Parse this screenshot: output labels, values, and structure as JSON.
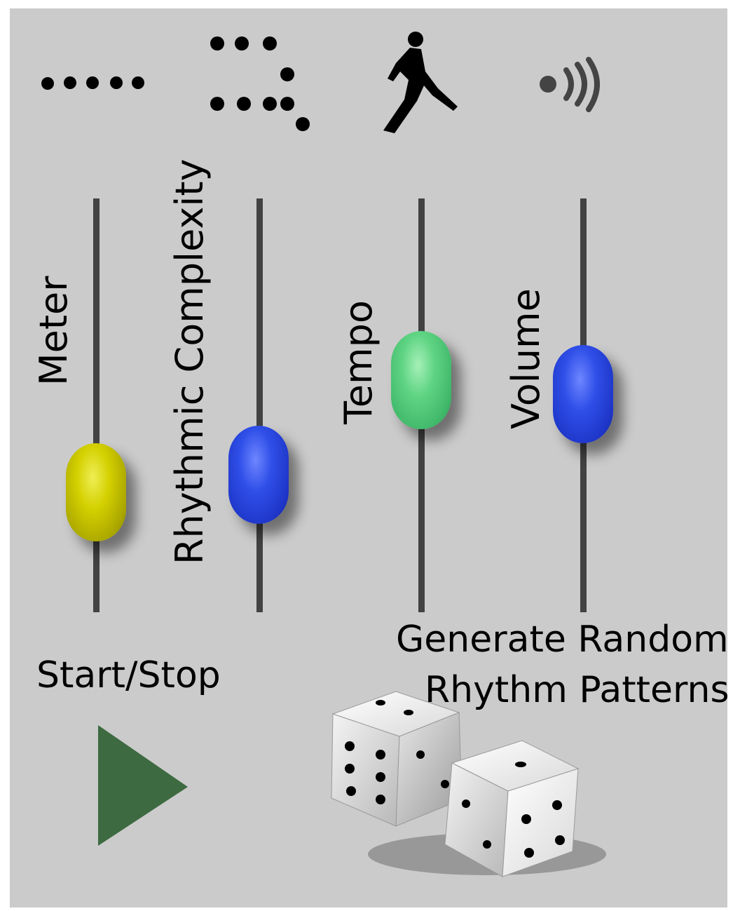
{
  "icons": {
    "meter": "four-dots-icon",
    "complexity": "dot-pattern-icon",
    "tempo": "runner-icon",
    "volume": "speaker-waves-icon",
    "play": "play-triangle-icon",
    "dice": "dice-icon"
  },
  "sliders": [
    {
      "label": "Meter",
      "color": "#c9c400",
      "level": 0.27
    },
    {
      "label": "Rhythmic Complexity",
      "color": "#2a46e0",
      "level": 0.31
    },
    {
      "label": "Tempo",
      "color": "#52cc78",
      "level": 0.57
    },
    {
      "label": "Volume",
      "color": "#2a46e0",
      "level": 0.54
    }
  ],
  "controls": {
    "start_stop_label": "Start/Stop",
    "generate_line1": "Generate Random",
    "generate_line2": "Rhythm Patterns"
  },
  "colors": {
    "panel_bg": "#cbcbcb",
    "track": "#424242",
    "play_button": "#3d6a40"
  }
}
